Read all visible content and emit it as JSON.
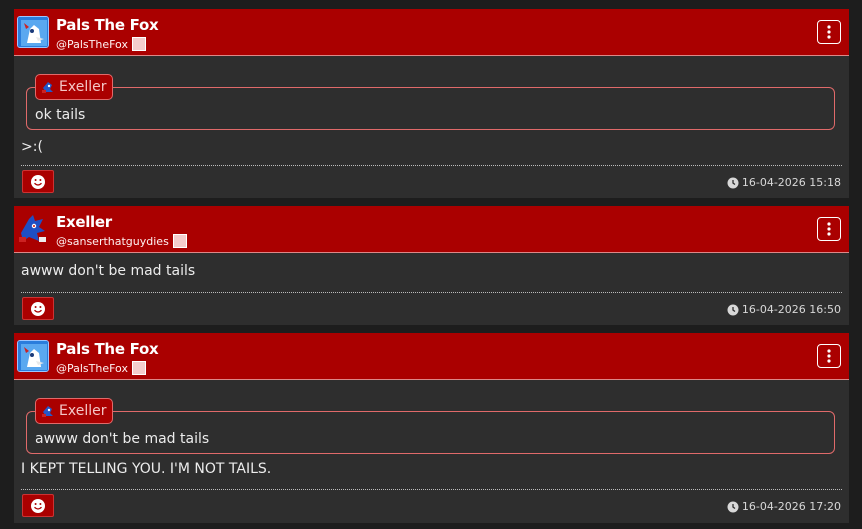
{
  "posts": [
    {
      "display_name": "Pals The Fox",
      "handle": "@PalsTheFox",
      "avatar": "pals-fox-avatar",
      "quote": {
        "author": "Exeller",
        "text": "ok tails"
      },
      "text": ">:(",
      "timestamp": "16-04-2026 15:18"
    },
    {
      "display_name": "Exeller",
      "handle": "@sanserthatguydies",
      "avatar": "exeller-avatar",
      "text": "awww don't be mad tails",
      "timestamp": "16-04-2026 16:50"
    },
    {
      "display_name": "Pals The Fox",
      "handle": "@PalsTheFox",
      "avatar": "pals-fox-avatar",
      "quote": {
        "author": "Exeller",
        "text": "awww don't be mad tails"
      },
      "text": "I KEPT TELLING YOU. I'M NOT TAILS.",
      "timestamp": "16-04-2026 17:20"
    }
  ],
  "icons": {
    "menu": "kebab-menu-icon",
    "react": "smiley-icon",
    "time": "clock-icon"
  },
  "colors": {
    "header": "#aa0000",
    "post_bg": "#2e2e2e",
    "page_bg": "#1d1d1d",
    "quote_border": "#e06a6a"
  }
}
